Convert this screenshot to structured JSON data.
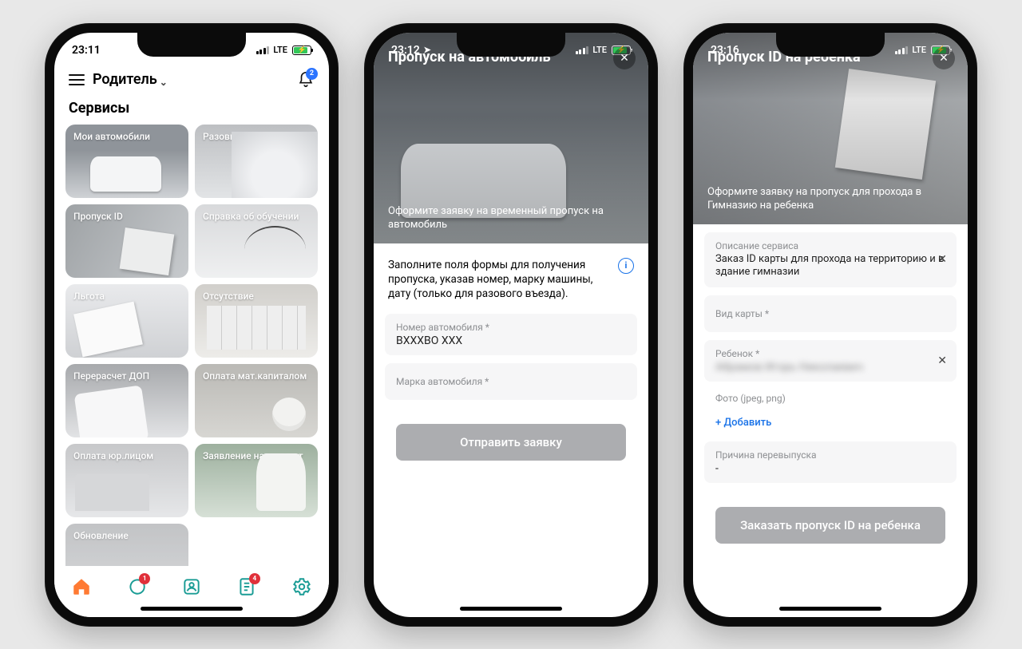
{
  "phone1": {
    "time": "23:11",
    "network": "LTE",
    "role": "Родитель",
    "notifications_badge": "2",
    "section_title": "Сервисы",
    "tiles": [
      "Мои автомобили",
      "Разовый пропуск",
      "Пропуск ID",
      "Справка об обучении",
      "Льгота",
      "Отсутствие",
      "Перерасчет ДОП",
      "Оплата мат.капиталом",
      "Оплата юр.лицом",
      "Заявление на дистант",
      "Обновление"
    ],
    "tab_chat_badge": "1",
    "tab_docs_badge": "4"
  },
  "phone2": {
    "time": "23:12",
    "network": "LTE",
    "title": "Пропуск на автомобиль",
    "subtitle": "Оформите заявку на временный пропуск на автомобиль",
    "info_text": "Заполните поля формы для получения пропуска, указав номер, марку машины, дату (только для разового въезда).",
    "field_plate_label": "Номер автомобиля *",
    "field_plate_value": "ВХХХВО ХХХ",
    "field_brand_label": "Марка автомобиля *",
    "submit": "Отправить заявку"
  },
  "phone3": {
    "time": "23:16",
    "network": "LTE",
    "title": "Пропуск ID на ребенка",
    "subtitle": "Оформите заявку на пропуск для прохода в Гимназию на ребенка",
    "desc_label": "Описание сервиса",
    "desc_value": "Заказ ID карты для прохода на территорию и в здание гимназии",
    "field_cardtype_label": "Вид карты *",
    "field_child_label": "Ребенок *",
    "field_child_value": "Абрамов Игорь Николаевич",
    "photo_label": "Фото (jpeg, png)",
    "add_link": "+ Добавить",
    "reason_label": "Причина перевыпуска",
    "reason_value": "-",
    "submit": "Заказать пропуск ID на ребенка"
  }
}
